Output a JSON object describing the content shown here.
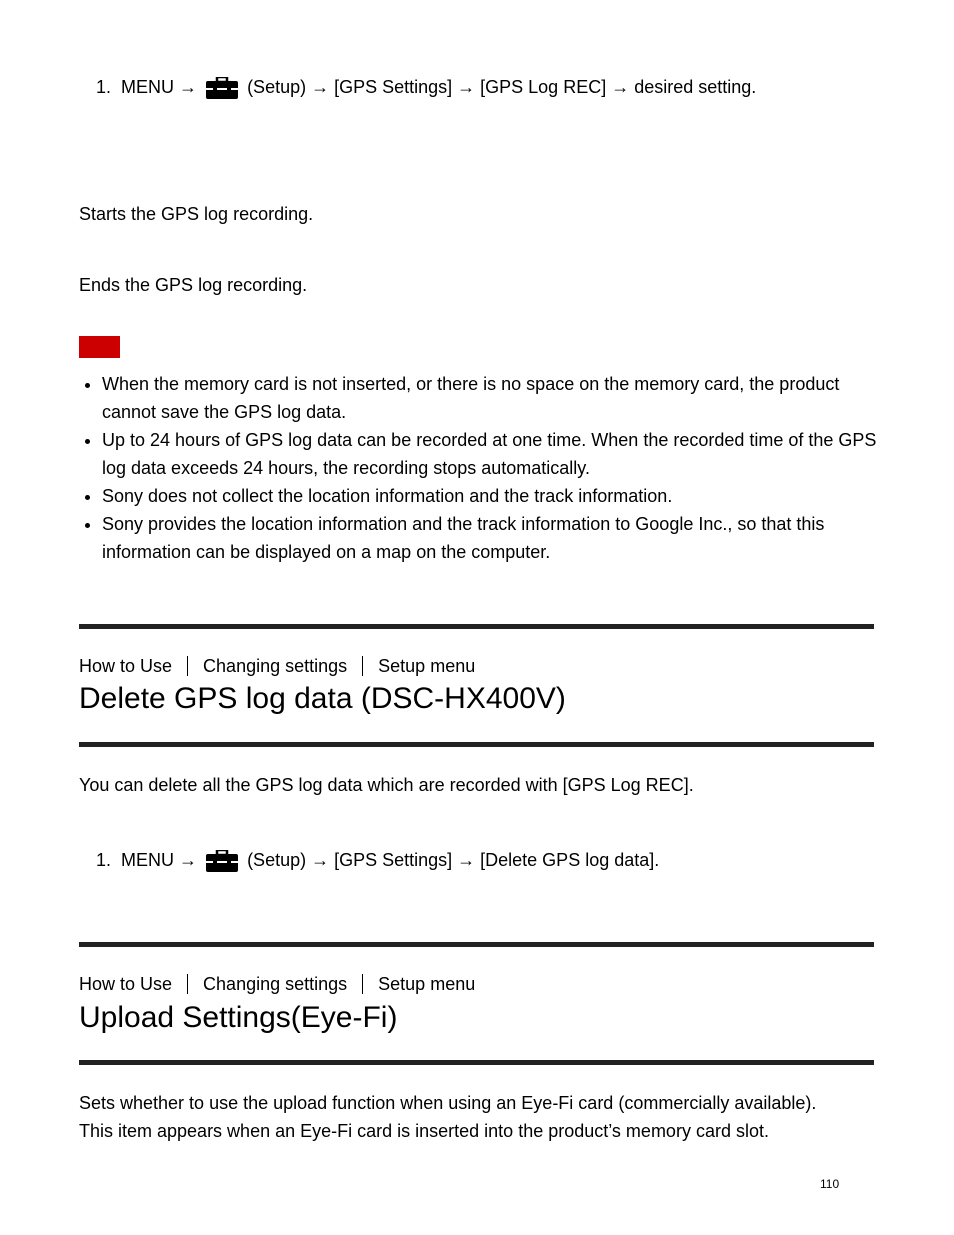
{
  "colors": {
    "note_badge": "#cc0000",
    "rule": "#222222"
  },
  "gps_log_rec": {
    "step1": {
      "num": "1.",
      "pre": "MENU →",
      "icon": "toolbox-icon",
      "post": "(Setup) → [GPS Settings] → [GPS Log REC] → desired setting."
    },
    "on_desc": "Starts the GPS log recording.",
    "off_desc": "Ends the GPS log recording.",
    "notes": [
      "When the memory card is not inserted, or there is no space on the memory card, the product cannot save the GPS log data.",
      "Up to 24 hours of GPS log data can be recorded at one time. When the recorded time of the GPS log data exceeds 24 hours, the recording stops automatically.",
      "Sony does not collect the location information and the track information.",
      "Sony provides the location information and the track information to Google Inc., so that this information can be displayed on a map on the computer."
    ]
  },
  "delete_section": {
    "breadcrumb": [
      "How to Use",
      "Changing settings",
      "Setup menu"
    ],
    "title": "Delete GPS log data (DSC-HX400V)",
    "intro": "You can delete all the GPS log data which are recorded with [GPS Log REC].",
    "step1": {
      "num": "1.",
      "pre": "MENU →",
      "icon": "toolbox-icon",
      "post": "(Setup) → [GPS Settings] → [Delete GPS log data]."
    }
  },
  "upload_section": {
    "breadcrumb": [
      "How to Use",
      "Changing settings",
      "Setup menu"
    ],
    "title": "Upload Settings(Eye-Fi)",
    "intro1": "Sets whether to use the upload function when using an Eye-Fi card (commercially available).",
    "intro2": "This item appears when an Eye-Fi card is inserted into the product’s memory card slot."
  },
  "page_number": "110"
}
